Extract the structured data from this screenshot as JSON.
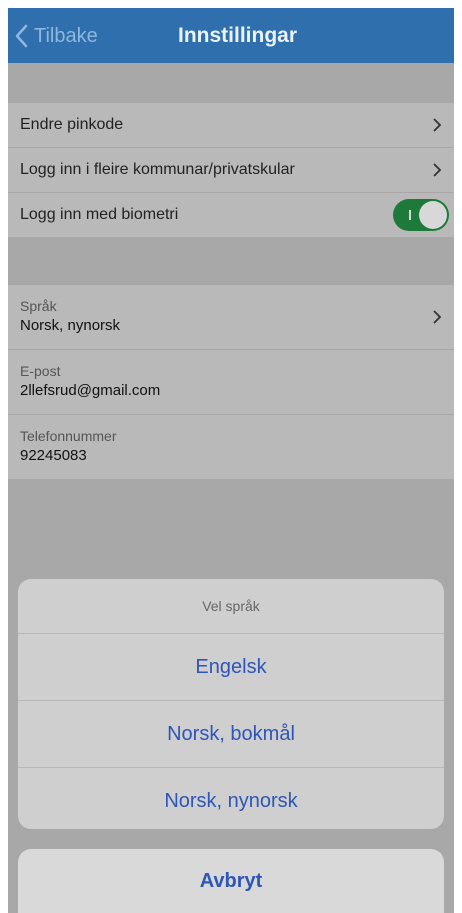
{
  "navbar": {
    "back_label": "Tilbake",
    "title": "Innstillingar"
  },
  "settings": {
    "items": [
      {
        "label": "Endre pinkode"
      },
      {
        "label": "Logg inn i fleire kommunar/privatskular"
      },
      {
        "label": "Logg inn med biometri"
      }
    ],
    "biometric_enabled": true
  },
  "profile": {
    "language": {
      "label": "Språk",
      "value": "Norsk, nynorsk"
    },
    "email": {
      "label": "E-post",
      "value": "2llefsrud@gmail.com"
    },
    "phone": {
      "label": "Telefonnummer",
      "value": "92245083"
    }
  },
  "language_sheet": {
    "title": "Vel språk",
    "options": [
      "Engelsk",
      "Norsk, bokmål",
      "Norsk, nynorsk"
    ],
    "cancel_label": "Avbryt"
  },
  "colors": {
    "navbar": "#2f6fae",
    "accent": "#2e56b8",
    "toggle_on": "#1d7a3a"
  }
}
